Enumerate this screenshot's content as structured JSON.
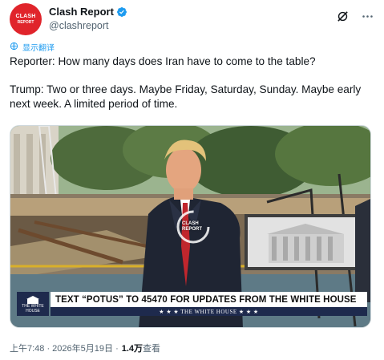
{
  "author": {
    "display_name": "Clash Report",
    "handle": "@clashreport",
    "avatar_line1": "CLASH",
    "avatar_line2": "REPORT"
  },
  "translate_label": "显示翻译",
  "tweet": {
    "line1": "Reporter: How many days does Iran have to come to the table?",
    "line2": "Trump: Two or three days. Maybe Friday, Saturday, Sunday. Maybe early next week. A limited period of time."
  },
  "media": {
    "chyron_main": "TEXT “POTUS” TO 45470 FOR UPDATES FROM THE WHITE HOUSE",
    "chyron_sub": "★ ★ ★   THE WHITE HOUSE   ★ ★ ★",
    "logo_text": "THE WHITE HOUSE",
    "watermark_line1": "CLASH",
    "watermark_line2": "REPORT"
  },
  "meta": {
    "time_date": "上午7:48 · 2026年5月19日 · ",
    "views_count": "1.4万",
    "views_label": " 查看"
  },
  "colors": {
    "accent": "#1d9bf0",
    "avatar_red": "#e0242b",
    "secondary_text": "#536471",
    "chyron_navy": "#1e2a4d"
  },
  "icons": {
    "verified": "verified-badge-icon",
    "grok": "grok-icon",
    "more": "more-options-icon",
    "translate": "translate-icon"
  }
}
